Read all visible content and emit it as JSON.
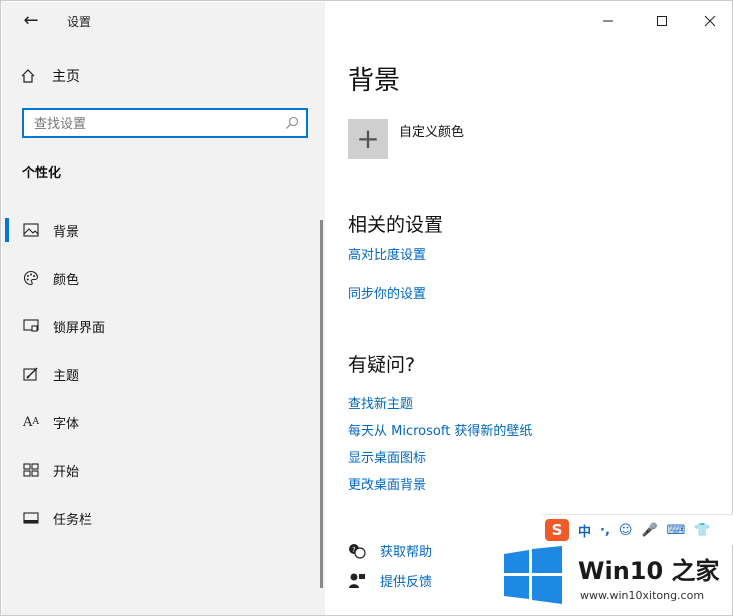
{
  "sidebar": {
    "app_title": "设置",
    "home_label": "主页",
    "search_placeholder": "查找设置",
    "section_title": "个性化",
    "items": [
      {
        "label": "背景",
        "icon": "picture-icon",
        "selected": true
      },
      {
        "label": "颜色",
        "icon": "palette-icon",
        "selected": false
      },
      {
        "label": "锁屏界面",
        "icon": "lock-screen-icon",
        "selected": false
      },
      {
        "label": "主题",
        "icon": "theme-brush-icon",
        "selected": false
      },
      {
        "label": "字体",
        "icon": "font-icon",
        "selected": false
      },
      {
        "label": "开始",
        "icon": "start-grid-icon",
        "selected": false
      },
      {
        "label": "任务栏",
        "icon": "taskbar-icon",
        "selected": false
      }
    ]
  },
  "titlebar": {
    "minimize": "minimize-icon",
    "maximize": "maximize-icon",
    "close": "close-icon"
  },
  "main": {
    "title": "背景",
    "custom_color_label": "自定义颜色",
    "related": {
      "heading": "相关的设置",
      "links": [
        "高对比度设置",
        "同步你的设置"
      ]
    },
    "questions": {
      "heading": "有疑问?",
      "links": [
        "查找新主题",
        "每天从 Microsoft 获得新的壁纸",
        "显示桌面图标",
        "更改桌面背景"
      ]
    },
    "help": [
      {
        "label": "获取帮助",
        "icon": "help-chat-icon"
      },
      {
        "label": "提供反馈",
        "icon": "feedback-icon"
      }
    ]
  },
  "overlay": {
    "ime_logo": "S",
    "ime_text": "中",
    "watermark_title": "Win10 之家",
    "watermark_url": "www.win10xitong.com"
  },
  "colors": {
    "accent": "#0078d7",
    "link": "#0067c0",
    "sidebar_bg": "#f2f2f2"
  }
}
